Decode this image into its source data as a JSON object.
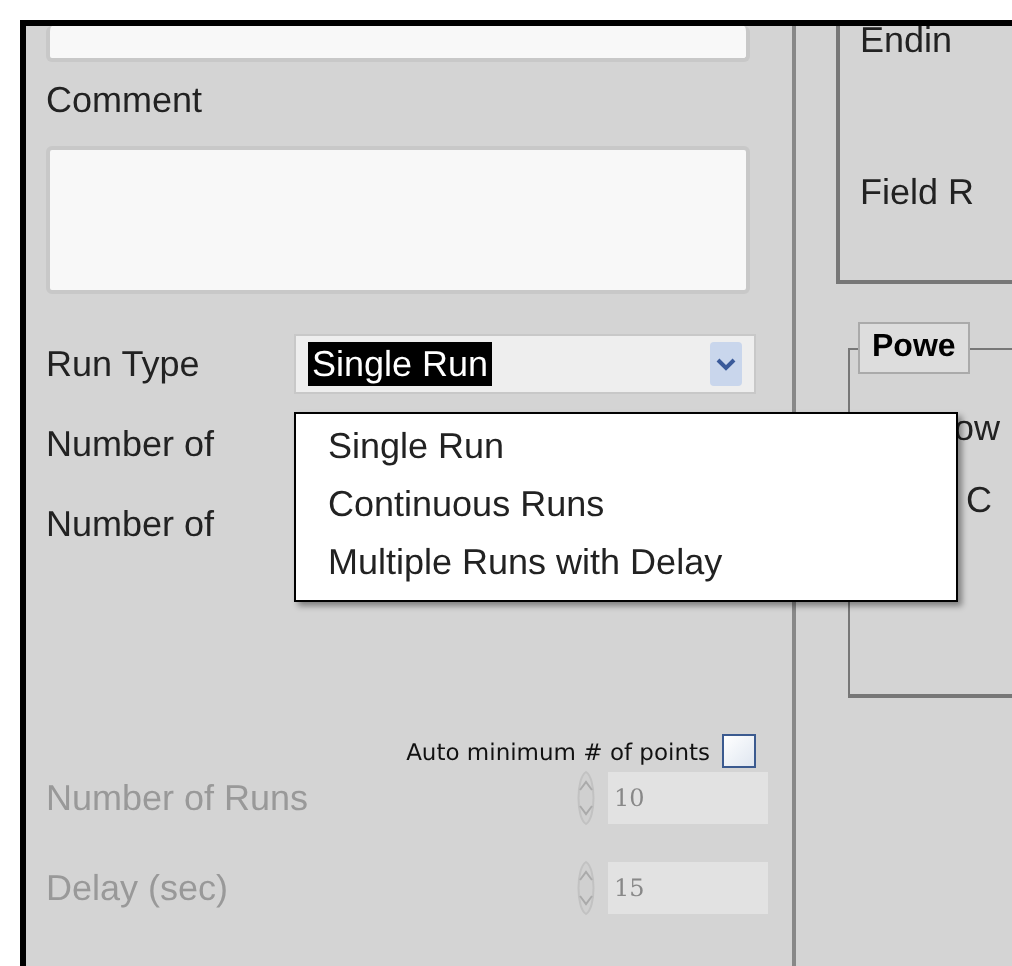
{
  "left": {
    "comment": {
      "label": "Comment"
    },
    "run_type": {
      "label": "Run Type",
      "value": "Single Run",
      "open": true,
      "options": [
        {
          "label": "Single Run"
        },
        {
          "label": "Continuous Runs"
        },
        {
          "label": "Multiple Runs with Delay"
        }
      ]
    },
    "covered_rows": [
      {
        "label": "Number of"
      },
      {
        "label": "Number of"
      }
    ],
    "auto_min": {
      "label": "Auto minimum # of points",
      "checked": false
    },
    "spin_fields": [
      {
        "label": "Number of Runs",
        "value": "10",
        "disabled": true
      },
      {
        "label": "Delay (sec)",
        "value": "15",
        "disabled": true
      }
    ]
  },
  "right": {
    "group_labels": [
      "Endin",
      "Field R"
    ],
    "power_group": {
      "tab": "Powe",
      "labels": [
        "ow",
        "C"
      ]
    }
  }
}
